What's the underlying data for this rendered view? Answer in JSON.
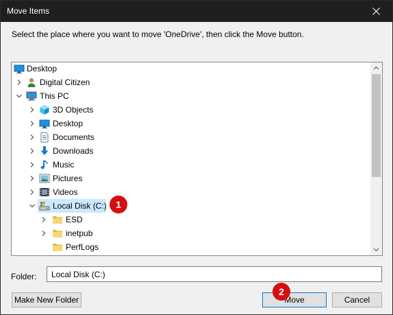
{
  "window": {
    "title": "Move Items",
    "close_symbol": "✕"
  },
  "instruction": "Select the place where you want to move 'OneDrive', then click the Move button.",
  "tree": [
    {
      "label": "Desktop",
      "icon": "desktop-icon",
      "chevron": "none",
      "level": 0,
      "selected": false
    },
    {
      "label": "Digital Citizen",
      "icon": "user-icon",
      "chevron": "right",
      "level": 1,
      "selected": false
    },
    {
      "label": "This PC",
      "icon": "computer-icon",
      "chevron": "down",
      "level": 1,
      "selected": false
    },
    {
      "label": "3D Objects",
      "icon": "cube-icon",
      "chevron": "right",
      "level": 2,
      "selected": false
    },
    {
      "label": "Desktop",
      "icon": "desktop-icon",
      "chevron": "right",
      "level": 2,
      "selected": false
    },
    {
      "label": "Documents",
      "icon": "document-icon",
      "chevron": "right",
      "level": 2,
      "selected": false
    },
    {
      "label": "Downloads",
      "icon": "download-arrow-icon",
      "chevron": "right",
      "level": 2,
      "selected": false
    },
    {
      "label": "Music",
      "icon": "music-note-icon",
      "chevron": "right",
      "level": 2,
      "selected": false
    },
    {
      "label": "Pictures",
      "icon": "pictures-icon",
      "chevron": "right",
      "level": 2,
      "selected": false
    },
    {
      "label": "Videos",
      "icon": "film-icon",
      "chevron": "right",
      "level": 2,
      "selected": false
    },
    {
      "label": "Local Disk (C:)",
      "icon": "drive-icon",
      "chevron": "down",
      "level": 2,
      "selected": true
    },
    {
      "label": "ESD",
      "icon": "folder-icon",
      "chevron": "right",
      "level": 3,
      "selected": false
    },
    {
      "label": "inetpub",
      "icon": "folder-icon",
      "chevron": "right",
      "level": 3,
      "selected": false
    },
    {
      "label": "PerfLogs",
      "icon": "folder-icon",
      "chevron": "none",
      "level": 3,
      "selected": false
    }
  ],
  "folder": {
    "label": "Folder:",
    "value": "Local Disk (C:)"
  },
  "buttons": {
    "new_folder": "Make New Folder",
    "move": "Move",
    "cancel": "Cancel"
  },
  "badges": {
    "one": "1",
    "two": "2"
  },
  "colors": {
    "titlebar": "#1f1f1f",
    "selection": "#cce8ff",
    "badge": "#d30f0f",
    "accent": "#0078d7"
  }
}
